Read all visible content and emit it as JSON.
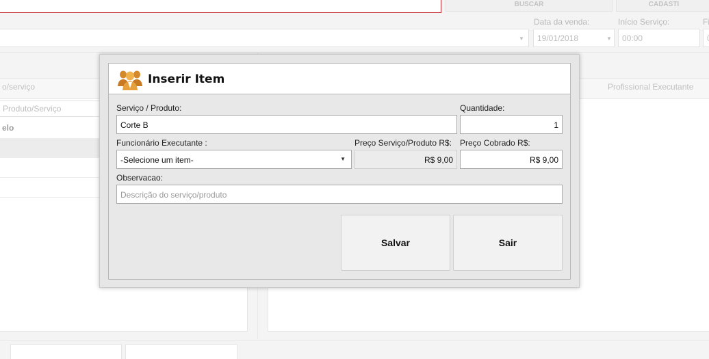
{
  "background": {
    "buttons": {
      "buscar": "BUSCAR",
      "cadastrar": "CADASTI"
    },
    "labels": {
      "sale_date": "Data da venda:",
      "service_start": "Início Serviço:",
      "cut_label": "Fi"
    },
    "inputs": {
      "sale_date": "19/01/2018",
      "service_start": "00:00",
      "cut_input": "0"
    },
    "left_table": {
      "header_cut": "o/serviço",
      "filter_placeholder": "Produto/Serviço",
      "rows": [
        "elo",
        "",
        "",
        ""
      ]
    },
    "right_table": {
      "header_professional": "Profissional Executante"
    }
  },
  "modal": {
    "title": "Inserir Item",
    "fields": {
      "service_product": {
        "label": "Serviço / Produto:",
        "value": "Corte B"
      },
      "quantity": {
        "label": "Quantidade:",
        "value": "1"
      },
      "employee": {
        "label": "Funcionário Executante :",
        "value": "-Selecione um item-"
      },
      "price_service": {
        "label": "Preço Serviço/Produto R$:",
        "value": "R$ 9,00"
      },
      "price_charged": {
        "label": "Preço Cobrado R$:",
        "value": "R$ 9,00"
      },
      "observation": {
        "label": "Observacao:",
        "placeholder": "Descrição do serviço/produto"
      }
    },
    "buttons": {
      "save": "Salvar",
      "exit": "Sair"
    }
  },
  "colors": {
    "accent_red": "#c4262e",
    "icon_orange": "#e8a03c"
  }
}
